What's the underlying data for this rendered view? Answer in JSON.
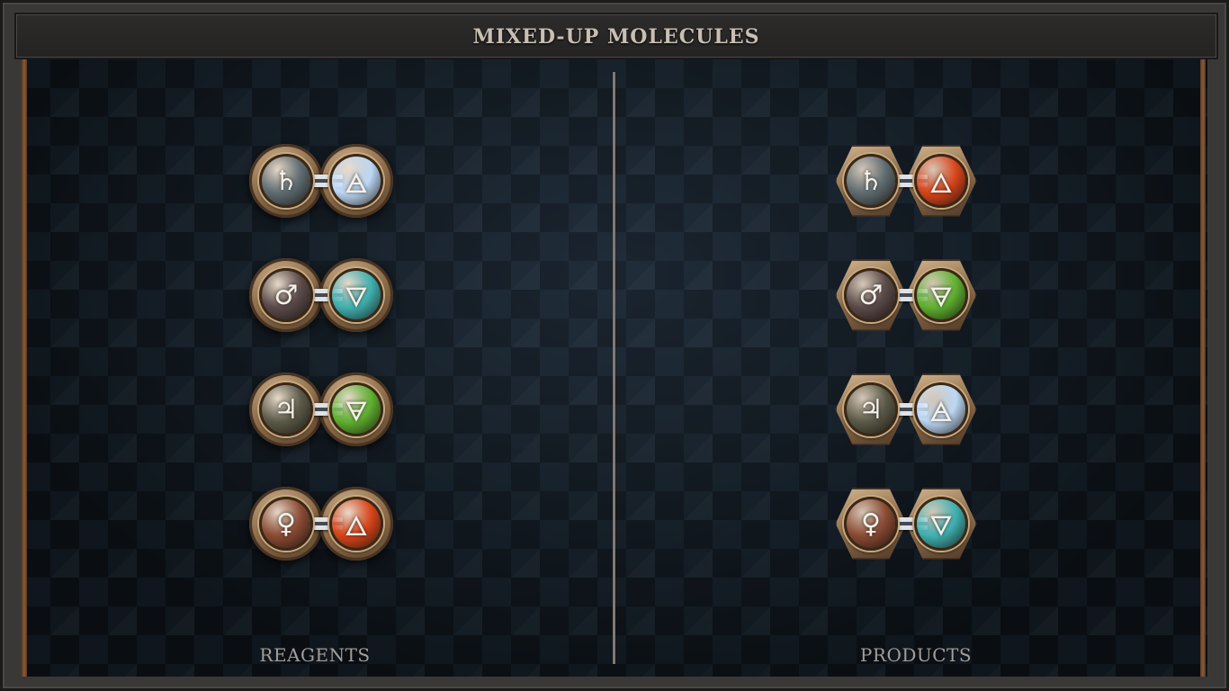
{
  "title": "MIXED-UP MOLECULES",
  "labels": {
    "left": "REAGENTS",
    "right": "PRODUCTS"
  },
  "reagents": [
    {
      "left": {
        "glyph": "♄",
        "element": "saturn",
        "color": "#5d6b70"
      },
      "right": {
        "glyph": "🜁",
        "element": "air",
        "color": "#bcd8f5"
      },
      "bond": "double"
    },
    {
      "left": {
        "glyph": "♂",
        "element": "mars",
        "color": "#5a4a4a"
      },
      "right": {
        "glyph": "🜄",
        "element": "water",
        "color": "#3fb0b0"
      },
      "bond": "double"
    },
    {
      "left": {
        "glyph": "♃",
        "element": "jupiter",
        "color": "#5b5a48"
      },
      "right": {
        "glyph": "🜃",
        "element": "earth",
        "color": "#5fb030"
      },
      "bond": "double"
    },
    {
      "left": {
        "glyph": "♀",
        "element": "venus",
        "color": "#8a4a33"
      },
      "right": {
        "glyph": "🜂",
        "element": "fire",
        "color": "#d9441a"
      },
      "bond": "double"
    }
  ],
  "products": [
    {
      "left": {
        "glyph": "♄",
        "element": "saturn",
        "color": "#5d6b70"
      },
      "right": {
        "glyph": "🜂",
        "element": "fire",
        "color": "#d9441a"
      },
      "bond": "double"
    },
    {
      "left": {
        "glyph": "♂",
        "element": "mars",
        "color": "#5a4a4a"
      },
      "right": {
        "glyph": "🜃",
        "element": "earth",
        "color": "#5fb030"
      },
      "bond": "double"
    },
    {
      "left": {
        "glyph": "♃",
        "element": "jupiter",
        "color": "#5b5a48"
      },
      "right": {
        "glyph": "🜁",
        "element": "air",
        "color": "#bcd8f5"
      },
      "bond": "double"
    },
    {
      "left": {
        "glyph": "♀",
        "element": "venus",
        "color": "#8a4a33"
      },
      "right": {
        "glyph": "🜄",
        "element": "water",
        "color": "#3fb0b0"
      },
      "bond": "double"
    }
  ]
}
